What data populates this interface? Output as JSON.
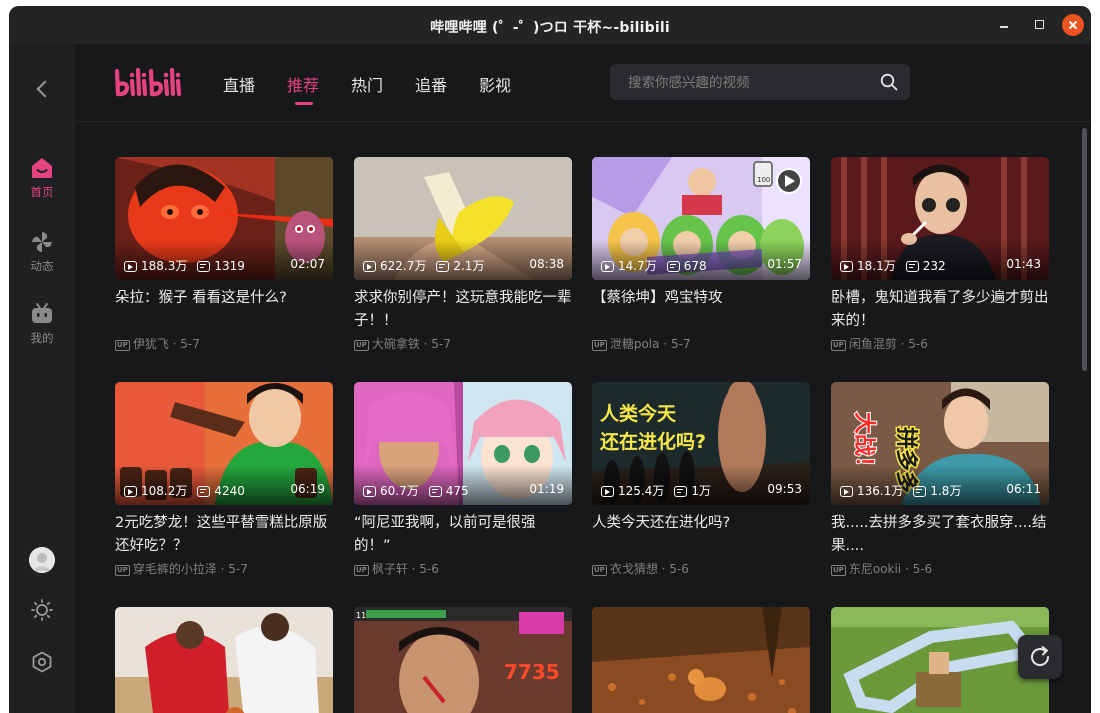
{
  "window": {
    "title": "哔哩哔哩 (゜-゜)つロ 干杯~-bilibili"
  },
  "sidebar": {
    "items": [
      {
        "label": "首页",
        "icon": "home-icon",
        "active": true
      },
      {
        "label": "动态",
        "icon": "pinwheel-icon",
        "active": false
      },
      {
        "label": "我的",
        "icon": "tv-icon",
        "active": false
      }
    ]
  },
  "header": {
    "logo": "bilibili",
    "tabs": [
      {
        "label": "直播"
      },
      {
        "label": "推荐"
      },
      {
        "label": "热门"
      },
      {
        "label": "追番"
      },
      {
        "label": "影视"
      }
    ],
    "active_tab": "推荐",
    "search_placeholder": "搜索你感兴趣的视频"
  },
  "colors": {
    "accent": "#e5427f",
    "background": "#17181a",
    "sidebar": "#1f2022"
  },
  "videos": [
    {
      "title": "朵拉：猴子 看看这是什么?",
      "views": "188.3万",
      "danmaku": "1319",
      "duration": "02:07",
      "uploader": "伊犹飞",
      "date": "5-7"
    },
    {
      "title": "求求你别停产！这玩意我能吃一辈子！！",
      "views": "622.7万",
      "danmaku": "2.1万",
      "duration": "08:38",
      "uploader": "大碗拿铁",
      "date": "5-7"
    },
    {
      "title": "【蔡徐坤】鸡宝特攻",
      "views": "14.7万",
      "danmaku": "678",
      "duration": "01:57",
      "uploader": "泄糖pola",
      "date": "5-7"
    },
    {
      "title": "卧槽，鬼知道我看了多少遍才剪出来的！",
      "views": "18.1万",
      "danmaku": "232",
      "duration": "01:43",
      "uploader": "闲鱼混剪",
      "date": "5-6"
    },
    {
      "title": "2元吃梦龙！这些平替雪糕比原版还好吃？？",
      "views": "108.2万",
      "danmaku": "4240",
      "duration": "06:19",
      "uploader": "穿毛裤的小拉泽",
      "date": "5-7"
    },
    {
      "title": "“阿尼亚我啊，以前可是很强的！”",
      "views": "60.7万",
      "danmaku": "475",
      "duration": "01:19",
      "uploader": "枫子轩",
      "date": "5-6"
    },
    {
      "title": "人类今天还在进化吗?",
      "views": "125.4万",
      "danmaku": "1万",
      "duration": "09:53",
      "uploader": "衣戈猜想",
      "date": "5-6"
    },
    {
      "title": "我.....去拼多多买了套衣服穿....结果....",
      "views": "136.1万",
      "danmaku": "1.8万",
      "duration": "06:11",
      "uploader": "东尼ookii",
      "date": "5-6"
    }
  ],
  "thumb_overlays": {
    "v7_text1": "人类今天",
    "v7_text2": "还在进化吗?",
    "v8_text1": "大战！",
    "v8_text2": "拼多多",
    "v3_badge": "100",
    "r3_b_count": "7735",
    "r3_b_level": "11"
  },
  "separator": " · "
}
